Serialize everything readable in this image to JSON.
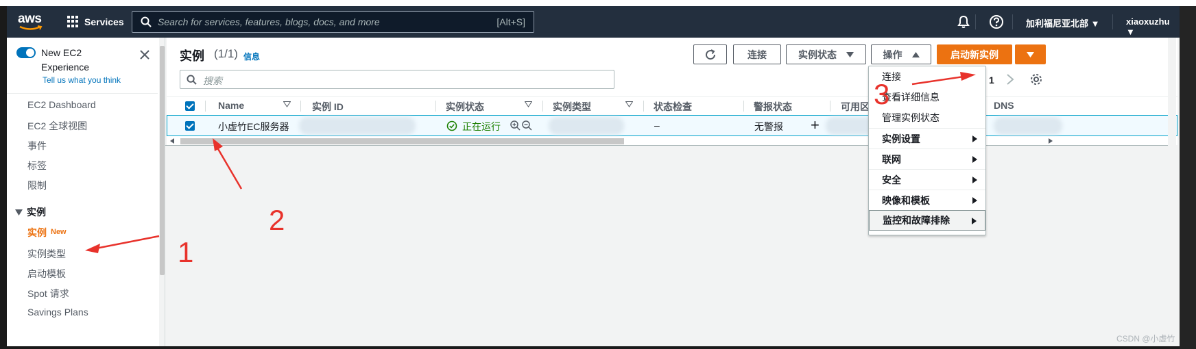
{
  "nav": {
    "logo_text": "aws",
    "services_label": "Services",
    "search_placeholder": "Search for services, features, blogs, docs, and more",
    "search_shortcut": "[Alt+S]",
    "region": "加利福尼亚北部 ▼",
    "user": "xiaoxuzhu ▼"
  },
  "sidebar": {
    "new_ec2_title": "New EC2 Experience",
    "tell_us": "Tell us what you think",
    "items": [
      "EC2 Dashboard",
      "EC2 全球视图",
      "事件",
      "标签",
      "限制"
    ],
    "section": "实例",
    "active_item": "实例",
    "active_badge": "New",
    "sub_items": [
      "实例类型",
      "启动模板",
      "Spot 请求",
      "Savings Plans"
    ]
  },
  "header": {
    "title": "实例",
    "count": "(1/1)",
    "info": "信息",
    "connect": "连接",
    "instance_state": "实例状态",
    "actions": "操作",
    "launch": "启动新实例",
    "filter_placeholder": "搜索",
    "page": "1"
  },
  "table": {
    "columns": [
      "Name",
      "实例 ID",
      "实例状态",
      "实例类型",
      "状态检查",
      "警报状态",
      "可用区",
      "DNS"
    ],
    "row": {
      "name": "小虚竹EC服务器",
      "state": "正在运行",
      "status_check": "–",
      "alarm": "无警报",
      "add": "+"
    }
  },
  "menu": {
    "items": [
      "连接",
      "查看详细信息",
      "管理实例状态"
    ],
    "groups": [
      "实例设置",
      "联网",
      "安全",
      "映像和模板",
      "监控和故障排除"
    ]
  },
  "annotations": [
    "1",
    "2",
    "3"
  ],
  "watermark": "CSDN @小虚竹",
  "colors": {
    "accent": "#ec7211",
    "link": "#0073bb",
    "nav_bg": "#232f3e",
    "running": "#1d8102",
    "annotation": "#e8322b"
  }
}
